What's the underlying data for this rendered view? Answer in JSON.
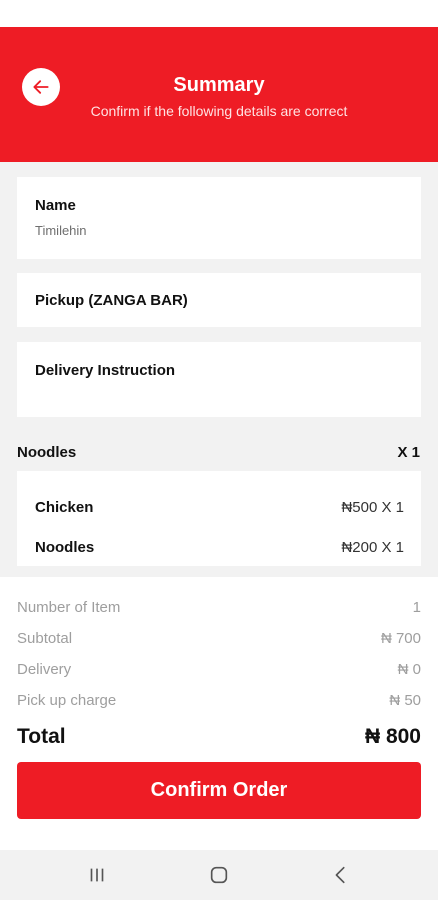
{
  "header": {
    "title": "Summary",
    "subtitle": "Confirm if the following details are correct",
    "back_icon": "arrow-left-icon",
    "color": "#ee1c25"
  },
  "details": {
    "name_label": "Name",
    "name_value": "Timilehin",
    "pickup_label": "Pickup (ZANGA BAR)",
    "delivery_instruction_label": "Delivery Instruction"
  },
  "order": {
    "item_name": "Noodles",
    "item_qty": "X 1",
    "addons": [
      {
        "name": "Chicken",
        "price": "₦500 X 1"
      },
      {
        "name": "Noodles",
        "price": "₦200 X 1"
      }
    ]
  },
  "summary": {
    "rows": [
      {
        "label": "Number of Item",
        "value": "1"
      },
      {
        "label": "Subtotal",
        "value": "₦ 700"
      },
      {
        "label": "Delivery",
        "value": "₦ 0"
      },
      {
        "label": "Pick up charge",
        "value": "₦ 50"
      }
    ],
    "total_label": "Total",
    "total_value": "₦ 800"
  },
  "confirm_label": "Confirm Order",
  "navbar": {
    "icons": [
      "recent-apps-icon",
      "home-icon",
      "back-icon"
    ]
  }
}
